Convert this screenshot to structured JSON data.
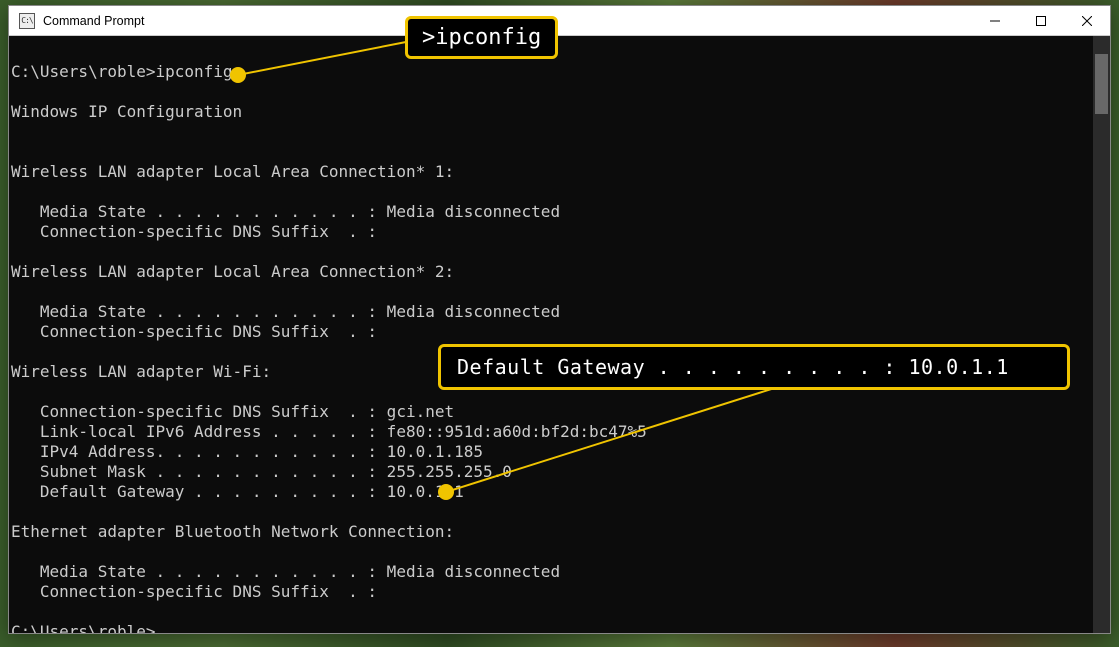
{
  "window": {
    "title": "Command Prompt",
    "icon_label": "C:\\"
  },
  "terminal": {
    "prompt1": "C:\\Users\\roble>",
    "command": "ipconfig",
    "heading": "Windows IP Configuration",
    "adapters": [
      {
        "name": "Wireless LAN adapter Local Area Connection* 1:",
        "lines": [
          "   Media State . . . . . . . . . . . : Media disconnected",
          "   Connection-specific DNS Suffix  . :"
        ]
      },
      {
        "name": "Wireless LAN adapter Local Area Connection* 2:",
        "lines": [
          "   Media State . . . . . . . . . . . : Media disconnected",
          "   Connection-specific DNS Suffix  . :"
        ]
      },
      {
        "name": "Wireless LAN adapter Wi-Fi:",
        "lines": [
          "   Connection-specific DNS Suffix  . : gci.net",
          "   Link-local IPv6 Address . . . . . : fe80::951d:a60d:bf2d:bc47%5",
          "   IPv4 Address. . . . . . . . . . . : 10.0.1.185",
          "   Subnet Mask . . . . . . . . . . . : 255.255.255.0",
          "   Default Gateway . . . . . . . . . : 10.0.1.1"
        ]
      },
      {
        "name": "Ethernet adapter Bluetooth Network Connection:",
        "lines": [
          "   Media State . . . . . . . . . . . : Media disconnected",
          "   Connection-specific DNS Suffix  . :"
        ]
      }
    ],
    "prompt2": "C:\\Users\\roble>"
  },
  "annotations": {
    "callout1": ">ipconfig",
    "callout2": "Default Gateway . . . . . . . . . : 10.0.1.1"
  }
}
